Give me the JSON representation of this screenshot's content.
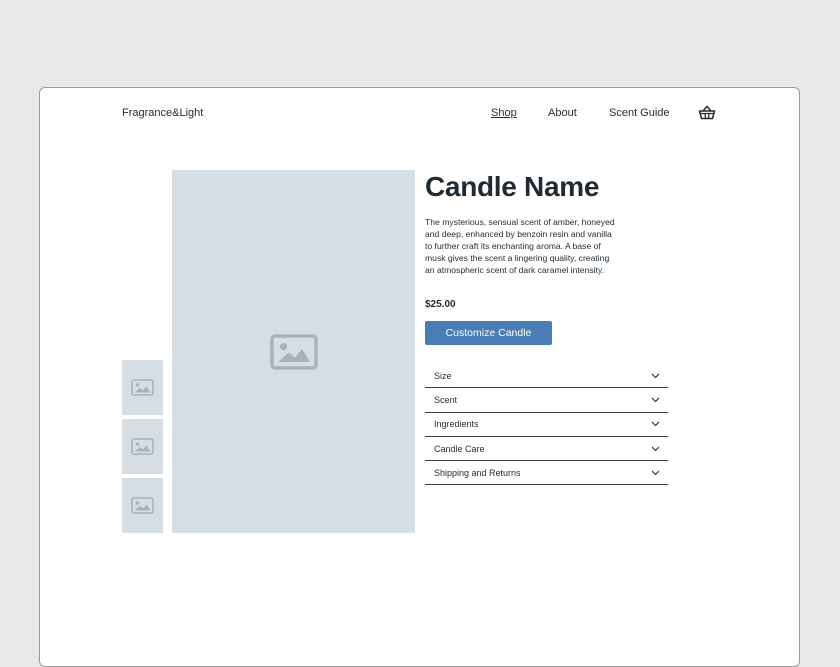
{
  "header": {
    "brand": "Fragrance&Light",
    "nav": {
      "shop": "Shop",
      "about": "About",
      "scent_guide": "Scent Guide"
    },
    "cart_icon": "basket-icon"
  },
  "product": {
    "name": "Candle Name",
    "description": "The mysterious, sensual scent of amber, honeyed and deep, enhanced by benzoin resin and vanilla to further craft its enchanting aroma. A base of musk gives the scent a lingering quality, creating an atmospheric scent of dark caramel intensity.",
    "price": "$25.00",
    "cta_label": "Customize Candle"
  },
  "accordion": [
    {
      "label": "Size"
    },
    {
      "label": "Scent"
    },
    {
      "label": "Ingredients"
    },
    {
      "label": "Candle Care"
    },
    {
      "label": "Shipping and Returns"
    }
  ],
  "colors": {
    "background": "#e8e8e8",
    "placeholder": "#d6dde3",
    "placeholder_icon": "#a9b2ba",
    "accent": "#4a7db5",
    "text": "#1f2a33"
  },
  "icons": {
    "image_placeholder": "image-placeholder-icon",
    "chevron": "chevron-down-icon"
  }
}
